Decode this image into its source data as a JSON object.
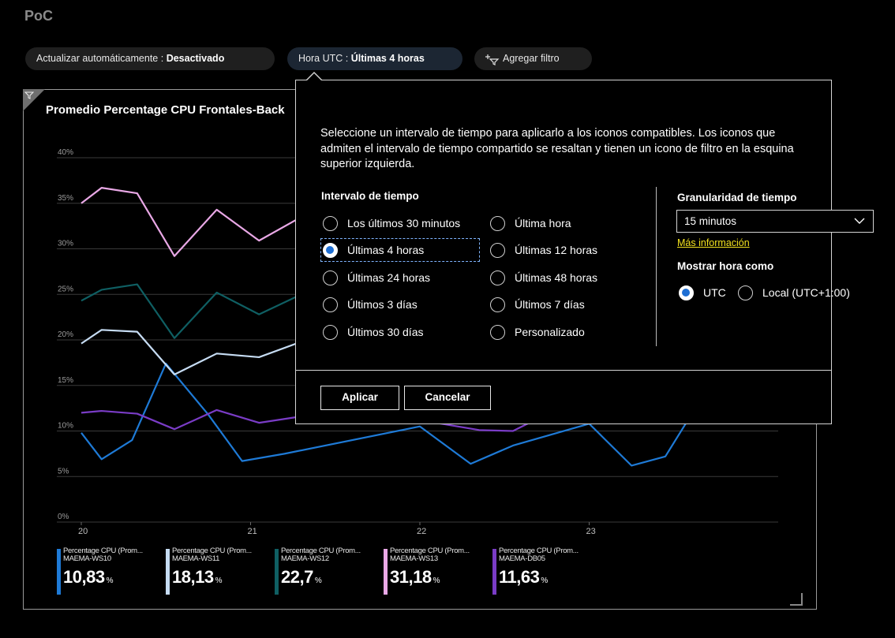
{
  "dashboard": {
    "title": "PoC"
  },
  "toolbar": {
    "auto_refresh_label": "Actualizar automáticamente :",
    "auto_refresh_value": "Desactivado",
    "time_label": "Hora UTC :",
    "time_value": "Últimas 4 horas",
    "add_filter_label": "Agregar filtro"
  },
  "tile": {
    "title": "Promedio Percentage CPU Frontales-Back"
  },
  "chart_data": {
    "type": "line",
    "y_ticks": [
      "40%",
      "35%",
      "30%",
      "25%",
      "20%",
      "15%",
      "10%",
      "5%",
      "0%"
    ],
    "x_ticks": [
      "20",
      "21",
      "22",
      "23"
    ],
    "ylim": [
      0,
      40
    ],
    "grid": true,
    "legend_position": "bottom",
    "series": [
      {
        "name": "Percentage CPU (Prom... MAEMA-WS10",
        "color": "#1e7ad6",
        "points": [
          [
            0,
            9.8
          ],
          [
            0.12,
            6.9
          ],
          [
            0.3,
            9.0
          ],
          [
            0.5,
            17.4
          ],
          [
            0.75,
            11.8
          ],
          [
            0.95,
            6.7
          ],
          [
            1.2,
            7.5
          ],
          [
            2.0,
            10.5
          ],
          [
            2.3,
            6.4
          ],
          [
            2.55,
            8.4
          ],
          [
            3.0,
            10.8
          ],
          [
            3.25,
            6.2
          ],
          [
            3.45,
            7.2
          ],
          [
            3.62,
            12.3
          ]
        ]
      },
      {
        "name": "Percentage CPU (Prom... MAEMA-WS11",
        "color": "#c6dcf3",
        "points": [
          [
            0,
            19.6
          ],
          [
            0.12,
            21.1
          ],
          [
            0.33,
            20.9
          ],
          [
            0.55,
            16.2
          ],
          [
            0.8,
            18.5
          ],
          [
            1.05,
            18.1
          ],
          [
            1.3,
            19.8
          ]
        ]
      },
      {
        "name": "Percentage CPU (Prom... MAEMA-WS12",
        "color": "#0f5f63",
        "points": [
          [
            0,
            24.3
          ],
          [
            0.12,
            25.5
          ],
          [
            0.33,
            26.1
          ],
          [
            0.55,
            20.2
          ],
          [
            0.8,
            25.2
          ],
          [
            1.05,
            22.8
          ],
          [
            1.3,
            25.0
          ]
        ]
      },
      {
        "name": "Percentage CPU (Prom... MAEMA-WS13",
        "color": "#e9a8e6",
        "points": [
          [
            0,
            35.0
          ],
          [
            0.12,
            36.7
          ],
          [
            0.33,
            36.1
          ],
          [
            0.55,
            29.2
          ],
          [
            0.8,
            34.3
          ],
          [
            1.05,
            30.9
          ],
          [
            1.3,
            33.5
          ]
        ]
      },
      {
        "name": "Percentage CPU (Prom... MAEMA-DB05",
        "color": "#7a3cc6",
        "points": [
          [
            0,
            12.0
          ],
          [
            0.12,
            12.2
          ],
          [
            0.33,
            11.9
          ],
          [
            0.55,
            10.2
          ],
          [
            0.8,
            12.3
          ],
          [
            1.05,
            10.9
          ],
          [
            1.3,
            11.6
          ],
          [
            2.0,
            11.2
          ],
          [
            2.35,
            10.1
          ],
          [
            2.55,
            10.0
          ],
          [
            2.7,
            11.4
          ]
        ]
      }
    ]
  },
  "legend": [
    {
      "line1": "Percentage CPU (Prom...",
      "line2": "MAEMA-WS10",
      "value": "10,83",
      "unit": "%",
      "color": "#1e7ad6"
    },
    {
      "line1": "Percentage CPU (Prom...",
      "line2": "MAEMA-WS11",
      "value": "18,13",
      "unit": "%",
      "color": "#c6dcf3"
    },
    {
      "line1": "Percentage CPU (Prom...",
      "line2": "MAEMA-WS12",
      "value": "22,7",
      "unit": "%",
      "color": "#0f5f63"
    },
    {
      "line1": "Percentage CPU (Prom...",
      "line2": "MAEMA-WS13",
      "value": "31,18",
      "unit": "%",
      "color": "#e9a8e6"
    },
    {
      "line1": "Percentage CPU (Prom...",
      "line2": "MAEMA-DB05",
      "value": "11,63",
      "unit": "%",
      "color": "#7a3cc6"
    }
  ],
  "time_popup": {
    "description": "Seleccione un intervalo de tiempo para aplicarlo a los iconos compatibles. Los iconos que admiten el intervalo de tiempo compartido se resaltan y tienen un icono de filtro en la esquina superior izquierda.",
    "interval_heading": "Intervalo de tiempo",
    "options": [
      "Los últimos 30 minutos",
      "Última hora",
      "Últimas 4 horas",
      "Últimas 12 horas",
      "Últimas 24 horas",
      "Últimas 48 horas",
      "Últimos 3 días",
      "Últimos 7 días",
      "Últimos 30 días",
      "Personalizado"
    ],
    "selected_option": "Últimas 4 horas",
    "granularity_heading": "Granularidad de tiempo",
    "granularity_value": "15 minutos",
    "more_info": "Más información",
    "show_time_heading": "Mostrar hora como",
    "tz_utc": "UTC",
    "tz_local": "Local (UTC+1:00)",
    "tz_selected": "UTC",
    "apply_label": "Aplicar",
    "cancel_label": "Cancelar"
  }
}
